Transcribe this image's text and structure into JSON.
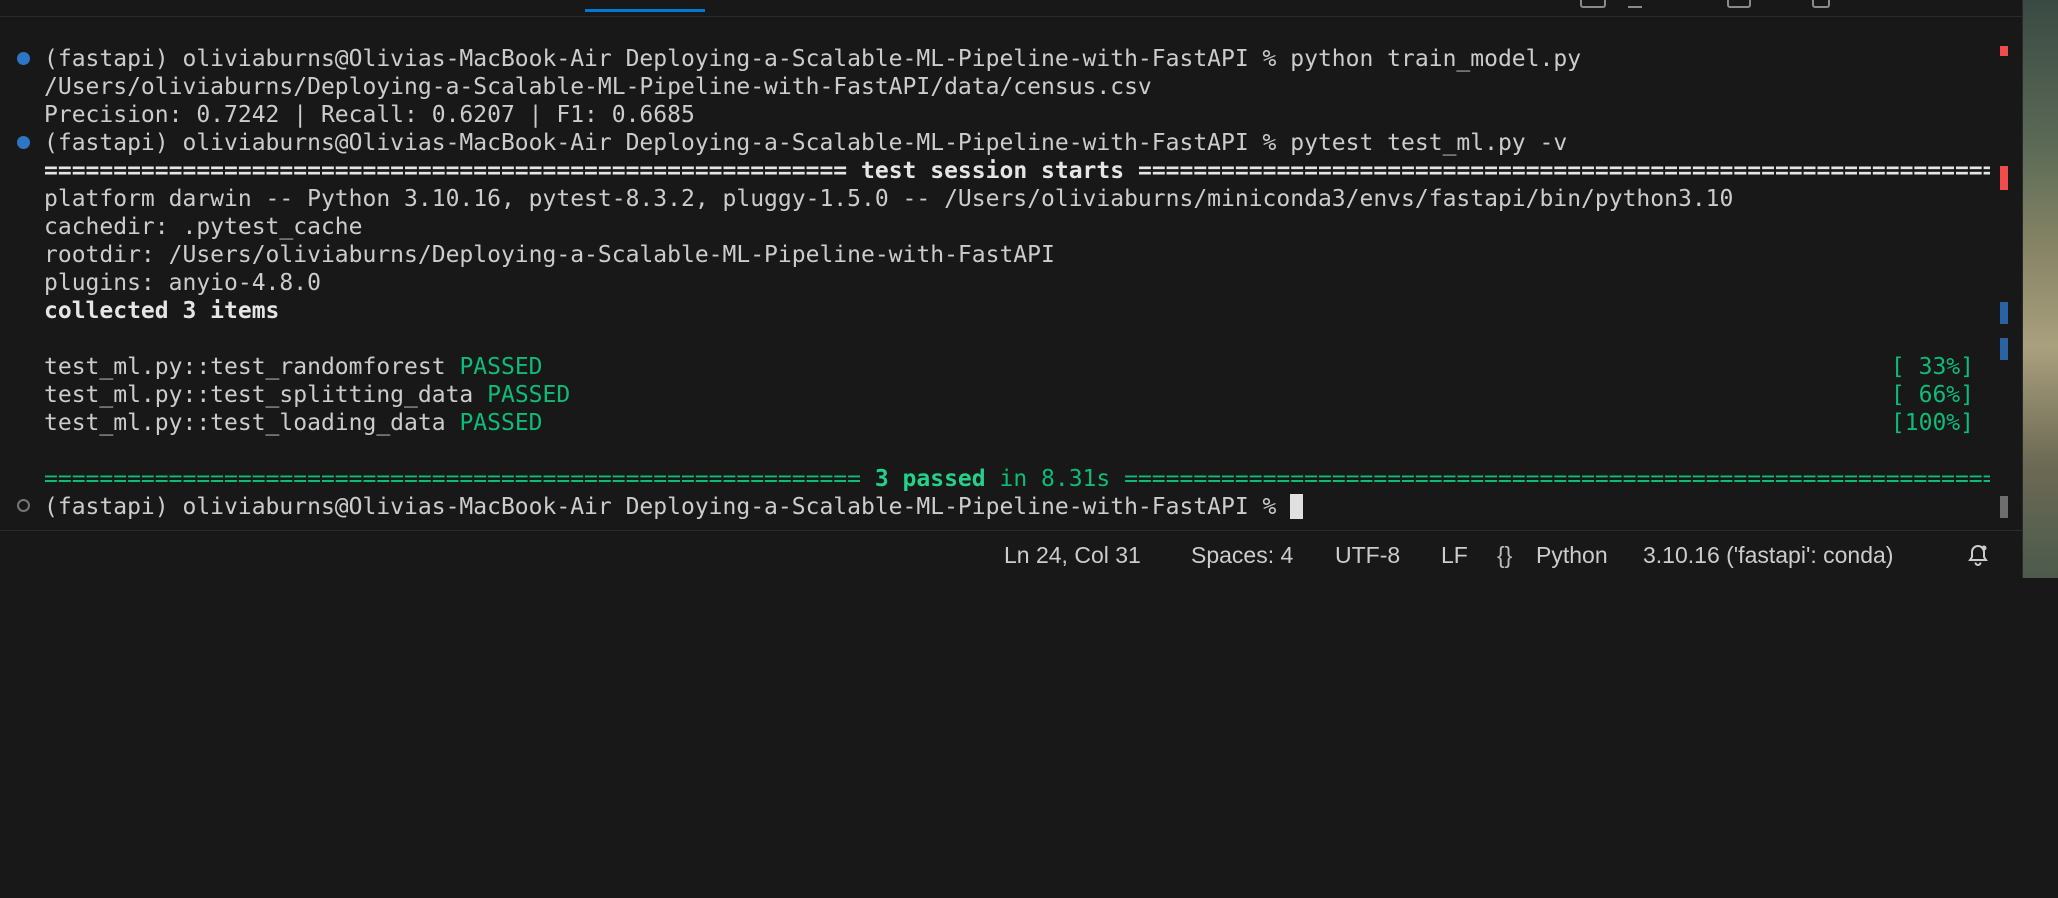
{
  "terminal": {
    "lines": [
      {
        "prompt": "(fastapi) oliviaburns@Olivias-MacBook-Air Deploying-a-Scalable-ML-Pipeline-with-FastAPI % ",
        "command": "python train_model.py"
      },
      {
        "text": "/Users/oliviaburns/Deploying-a-Scalable-ML-Pipeline-with-FastAPI/data/census.csv"
      },
      {
        "text": "Precision: 0.7242 | Recall: 0.6207 | F1: 0.6685"
      },
      {
        "prompt": "(fastapi) oliviaburns@Olivias-MacBook-Air Deploying-a-Scalable-ML-Pipeline-with-FastAPI % ",
        "command": "pytest test_ml.py -v"
      },
      {
        "text": "platform darwin -- Python 3.10.16, pytest-8.3.2, pluggy-1.5.0 -- /Users/oliviaburns/miniconda3/envs/fastapi/bin/python3.10"
      },
      {
        "text": "cachedir: .pytest_cache"
      },
      {
        "text": "rootdir: /Users/oliviaburns/Deploying-a-Scalable-ML-Pipeline-with-FastAPI"
      },
      {
        "text": "plugins: anyio-4.8.0"
      },
      {
        "text": "collected 3 items"
      },
      {
        "prompt": "(fastapi) oliviaburns@Olivias-MacBook-Air Deploying-a-Scalable-ML-Pipeline-with-FastAPI % "
      }
    ],
    "session_header": {
      "left_rule": "==========================================================",
      "title": "test session starts",
      "right_rule": "=================================================================="
    },
    "tests": [
      {
        "name": "test_ml.py::test_randomforest",
        "status": "PASSED",
        "progress": "[ 33%]"
      },
      {
        "name": "test_ml.py::test_splitting_data",
        "status": "PASSED",
        "progress": "[ 66%]"
      },
      {
        "name": "test_ml.py::test_loading_data",
        "status": "PASSED",
        "progress": "[100%]"
      }
    ],
    "summary": {
      "left_rule": "=========================================================== ",
      "passed": "3 passed",
      "time": " in 8.31s ",
      "right_rule": "================================================================="
    }
  },
  "status_bar": {
    "cursor_position": "Ln 24, Col 31",
    "indentation": "Spaces: 4",
    "encoding": "UTF-8",
    "line_ending": "LF",
    "language_icon": "{}",
    "language": "Python",
    "interpreter": "3.10.16 ('fastapi': conda)",
    "notifications_icon": "bell-icon"
  },
  "colors": {
    "background": "#181818",
    "text": "#cccccc",
    "passed": "#23d18b",
    "accent": "#0078d4",
    "error_marker": "#f14c4c",
    "info_marker": "#3794ff"
  }
}
